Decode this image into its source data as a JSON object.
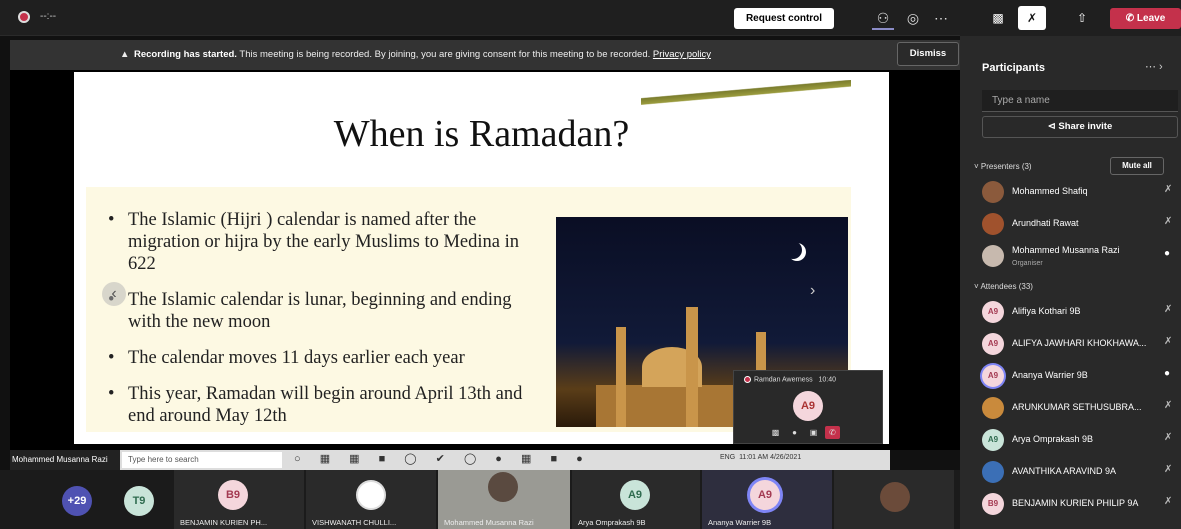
{
  "topbar": {
    "timer": "--:--",
    "request_control": "Request control",
    "leave": "Leave"
  },
  "notice": {
    "bold": "Recording has started.",
    "text": " This meeting is being recorded. By joining, you are giving consent for this meeting to be recorded. ",
    "link": "Privacy policy",
    "dismiss": "Dismiss"
  },
  "slide": {
    "title": "When is Ramadan?",
    "bullets": [
      "The Islamic (Hijri ) calendar is named after the migration or hijra by the early Muslims to Medina in 622",
      "The Islamic calendar is lunar, beginning and ending with the new moon",
      "The calendar moves 11 days earlier each year",
      "This year, Ramadan will begin around April 13th and end around May 12th"
    ]
  },
  "mini_window": {
    "title": "Ramdan Awerness",
    "time": "10:40",
    "avatar": "A9"
  },
  "taskbar": {
    "presenter_name": "Mohammed Musanna Razi",
    "search_placeholder": "Type here to search",
    "lang": "ENG",
    "clock": "11:01 AM",
    "date": "4/26/2021"
  },
  "gallery": [
    {
      "initials": "+29",
      "label": "",
      "bg": "#4f52b2",
      "fg": "#ffffff"
    },
    {
      "initials": "T9",
      "label": "",
      "bg": "#c9e4d9",
      "fg": "#2f6b4f"
    },
    {
      "initials": "B9",
      "label": "BENJAMIN KURIEN PH...",
      "bg": "#f4d6dc",
      "fg": "#a33a52"
    },
    {
      "initials": "",
      "label": "VISHWANATH CHULLI...",
      "bg": "#ffffff",
      "fg": "#333333"
    },
    {
      "initials": "",
      "label": "Mohammed Musanna Razi",
      "bg": "#8a8a8a",
      "fg": "#ffffff"
    },
    {
      "initials": "A9",
      "label": "Arya Omprakash 9B",
      "bg": "#c9e4d9",
      "fg": "#2f6b4f"
    },
    {
      "initials": "A9",
      "label": "Ananya Warrier 9B",
      "bg": "#f4d6dc",
      "fg": "#a33a52"
    },
    {
      "initials": "",
      "label": "",
      "bg": "#6b4b3a",
      "fg": "#ffffff"
    }
  ],
  "panel": {
    "title": "Participants",
    "search_placeholder": "Type a name",
    "share_invite": "Share invite",
    "presenters_heading": "Presenters (3)",
    "mute_all": "Mute all",
    "attendees_heading": "Attendees (33)",
    "presenters": [
      {
        "name": "Mohammed Shafiq",
        "sub": "",
        "initials": "",
        "bg": "#8b5a3c"
      },
      {
        "name": "Arundhati Rawat",
        "sub": "",
        "initials": "",
        "bg": "#a0522d"
      },
      {
        "name": "Mohammed Musanna Razi",
        "sub": "Organiser",
        "initials": "",
        "bg": "#c7b9ae"
      }
    ],
    "attendees": [
      {
        "name": "Alifiya Kothari 9B",
        "initials": "A9",
        "bg": "#f4d6dc",
        "fg": "#a33a52"
      },
      {
        "name": "ALIFYA JAWHARI KHOKHAWA...",
        "initials": "A9",
        "bg": "#f4d6dc",
        "fg": "#a33a52"
      },
      {
        "name": "Ananya Warrier 9B",
        "initials": "A9",
        "bg": "#f4d6dc",
        "fg": "#a33a52"
      },
      {
        "name": "ARUNKUMAR SETHUSUBRA...",
        "initials": "",
        "bg": "#c98a3c",
        "fg": "#ffffff"
      },
      {
        "name": "Arya Omprakash 9B",
        "initials": "A9",
        "bg": "#c9e4d9",
        "fg": "#2f6b4f"
      },
      {
        "name": "AVANTHIKA ARAVIND 9A",
        "initials": "",
        "bg": "#3b6fb6",
        "fg": "#ffffff"
      },
      {
        "name": "BENJAMIN KURIEN PHILIP 9A",
        "initials": "B9",
        "bg": "#f4d6dc",
        "fg": "#a33a52"
      }
    ]
  }
}
